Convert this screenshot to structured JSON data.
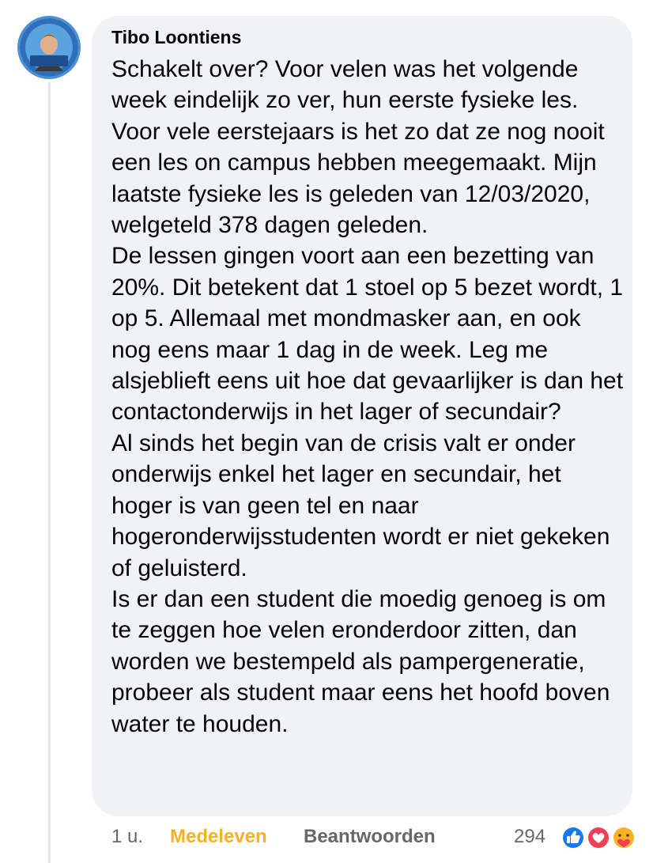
{
  "comment": {
    "author": "Tibo Loontiens",
    "paragraphs": [
      "Schakelt over? Voor velen was het volgende week eindelijk zo ver, hun eerste fysieke les. Voor vele eerstejaars is het zo dat ze nog nooit een les on campus hebben meegemaakt. Mijn laatste fysieke les is geleden van 12/03/2020, welgeteld 378 dagen geleden.",
      "De lessen gingen voort aan een bezetting van 20%. Dit betekent dat 1 stoel op 5 bezet wordt, 1 op 5. Allemaal met mondmasker aan, en ook nog eens maar 1 dag in de week. Leg me alsjeblieft eens uit hoe dat gevaarlijker is dan het contactonderwijs in het lager of secundair?",
      "Al sinds het begin van de crisis valt er onder onderwijs enkel het lager en secundair, het hoger is van geen tel en naar hogeronderwijsstudenten wordt er niet gekeken of geluisterd.",
      "Is er dan een student die moedig genoeg is om te zeggen hoe velen eronderdoor zitten, dan worden we bestempeld als pampergeneratie, probeer als student maar eens het hoofd boven water te houden."
    ]
  },
  "actions": {
    "time": "1 u.",
    "care_label": "Medeleven",
    "reply_label": "Beantwoorden",
    "reaction_count": "294"
  },
  "reactions": [
    "like-icon",
    "love-icon",
    "care-icon"
  ],
  "colors": {
    "bubble": "#f0f2f5",
    "care_yellow": "#f7b125",
    "like_blue": "#1877f2",
    "love_red": "#f33e58",
    "avatar_ring": "#4a90d9"
  }
}
